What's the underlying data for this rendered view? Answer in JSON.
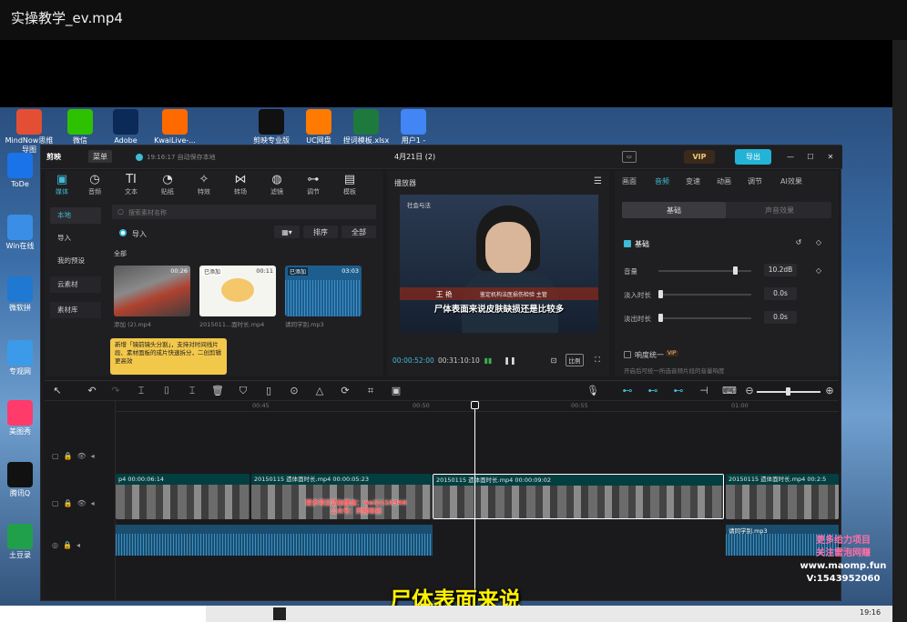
{
  "window_title": "实操教学_ev.mp4",
  "desktop_icons": [
    {
      "label": "MindNow思维导图",
      "color": "#e34f34"
    },
    {
      "label": "微信",
      "color": "#2dc100"
    },
    {
      "label": "Adobe Photosh...",
      "color": "#0b2a58"
    },
    {
      "label": "KwaiLive-...",
      "color": "#ff6a00"
    },
    {
      "label": "剪映专业版",
      "color": "#111111"
    },
    {
      "label": "UC网盘",
      "color": "#ff7a00"
    },
    {
      "label": "捏词模板.xlsx",
      "color": "#1d7a3c"
    },
    {
      "label": "用户1 - Chrome",
      "color": "#4285f4"
    },
    {
      "label": "ToDe",
      "color": "#1a73e8"
    },
    {
      "label": "Win在线",
      "color": "#3a8ee6"
    },
    {
      "label": "微软拼",
      "color": "#1f78d1"
    },
    {
      "label": "专观网",
      "color": "#3c9be8"
    },
    {
      "label": "美图秀",
      "color": "#ff3b6b"
    },
    {
      "label": "腾讯Q",
      "color": "#111111"
    },
    {
      "label": "土豆录",
      "color": "#20a04a"
    }
  ],
  "app": {
    "brand": "剪映",
    "menu_label": "菜单",
    "autosave": "19:16:17 自动保存本地",
    "project_name": "4月21日 (2)",
    "export_label": "导出",
    "vip_label": "VIP",
    "top_tools": [
      "媒体",
      "音频",
      "文本",
      "贴纸",
      "特效",
      "转场",
      "滤镜",
      "调节",
      "模板"
    ],
    "sidebar": [
      "本地",
      "导入",
      "我的预设",
      "云素材",
      "素材库"
    ],
    "search_placeholder": "搜索素材名称",
    "import_label": "导入",
    "sort_label": "排序",
    "all_label": "全部",
    "section_all": "全部",
    "media_items": [
      {
        "name": "添加 (2).mp4",
        "duration": "00:26",
        "badge": ""
      },
      {
        "name": "2015011...面时长.mp4",
        "duration": "00:11",
        "badge": "已添加"
      },
      {
        "name": "请同学别.mp3",
        "duration": "03:03",
        "badge": "已添加"
      }
    ],
    "tooltip": "新增「镜前镜头分割」，支持对时间线片段、素材面板的成片快速拆分，二创剪辑更高效",
    "player": {
      "title": "播放器",
      "current_time": "00:00:52:00",
      "total_time": "00:31:10:10",
      "ratio_label": "比例",
      "video_caption": "尸体表面来说皮肤缺损还是比较多",
      "video_top_text": "社会与法",
      "name_tag": "王 艳",
      "name_sub": "鉴定机构法医损伤检验 主管"
    },
    "props": {
      "tabs": [
        "画面",
        "音频",
        "变速",
        "动画",
        "调节",
        "AI效果"
      ],
      "active_tab": "音频",
      "subtabs": [
        "基础",
        "声音效果"
      ],
      "section_basic": "基础",
      "volume_label": "音量",
      "volume_value": "10.2dB",
      "volume_level": 0.82,
      "fadein_label": "淡入时长",
      "fadein_value": "0.0s",
      "fadeout_label": "淡出时长",
      "fadeout_value": "0.0s",
      "normalize_label": "响度统一",
      "normalize_desc": "开启后可统一所选音频片段的音量响度",
      "vip": "VIP"
    },
    "timeline": {
      "ruler_labels": [
        "00:45",
        "00:50",
        "00:55",
        "01:00"
      ],
      "clips": [
        {
          "title": "p4  00:00:06:14",
          "active": false
        },
        {
          "title": "20150115 遗体面时长.mp4  00:00:05:23",
          "active": false
        },
        {
          "title": "20150115 遗体面时长.mp4  00:00:09:02",
          "active": true
        },
        {
          "title": "20150115 遗体面时长.mp4  00:2:5",
          "active": false
        }
      ],
      "caption_lines": [
        "更多项目请加微信：wei2110948",
        "公众号：同频轻创"
      ],
      "audio_clip_label": "请同学别.mp3"
    }
  },
  "subtitle": "尸体表面来说",
  "watermark": [
    "更多给力项目",
    "关注雷泡网赚",
    "www.maomp.fun",
    "V:1543952060"
  ],
  "taskbar_time": "19:16"
}
